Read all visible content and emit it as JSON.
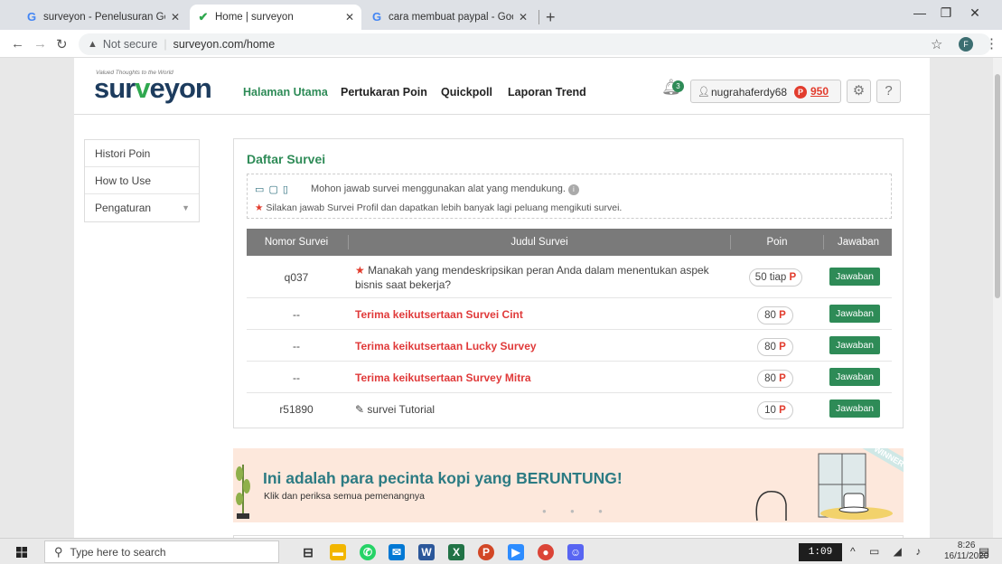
{
  "browser": {
    "tabs": [
      {
        "title": "surveyon - Penelusuran Google",
        "favicon": "G"
      },
      {
        "title": "Home | surveyon",
        "favicon": "✔"
      },
      {
        "title": "cara membuat paypal - Google S",
        "favicon": "G"
      }
    ],
    "not_secure": "Not secure",
    "url": "surveyon.com/home",
    "profile_initial": "F"
  },
  "site": {
    "tagline": "Valued Thoughts to the World",
    "logo_a": "sur",
    "logo_b": "v",
    "logo_c": "eyon",
    "nav": [
      "Halaman Utama",
      "Pertukaran Poin",
      "Quickpoll",
      "Laporan Trend"
    ],
    "notification_count": "3",
    "username": "nugrahaferdy68",
    "points_badge": "P",
    "points": "950",
    "help": "?"
  },
  "sidebar": {
    "items": [
      {
        "label": "Histori Poin"
      },
      {
        "label": "How to Use"
      },
      {
        "label": "Pengaturan"
      }
    ]
  },
  "survey": {
    "title": "Daftar Survei",
    "notice_device": "Mohon jawab survei menggunakan alat yang mendukung.",
    "notice_profile": "Silakan jawab Survei Profil dan dapatkan lebih banyak lagi peluang mengikuti survei.",
    "columns": [
      "Nomor Survei",
      "Judul Survei",
      "Poin",
      "Jawaban"
    ],
    "rows": [
      {
        "num": "q037",
        "title": "Manakah yang mendeskripsikan peran Anda dalam menentukan aspek bisnis saat bekerja?",
        "points": "50 tiap",
        "p": "P",
        "action": "Jawaban"
      },
      {
        "num": "--",
        "title": "Terima keikutsertaan Survei Cint",
        "points": "80",
        "p": "P",
        "action": "Jawaban"
      },
      {
        "num": "--",
        "title": "Terima keikutsertaan Lucky Survey",
        "points": "80",
        "p": "P",
        "action": "Jawaban"
      },
      {
        "num": "--",
        "title": "Terima keikutsertaan Survey Mitra",
        "points": "80",
        "p": "P",
        "action": "Jawaban"
      },
      {
        "num": "r51890",
        "title": "survei Tutorial",
        "points": "10",
        "p": "P",
        "action": "Jawaban"
      }
    ]
  },
  "banner": {
    "title": "Ini adalah para pecinta kopi yang BERUNTUNG!",
    "subtitle": "Klik dan periksa semua pemenangnya",
    "badge": "WINNER"
  },
  "taskbar": {
    "search_placeholder": "Type here to search",
    "media_time": "1:09",
    "time": "8:26",
    "date": "16/11/2020"
  },
  "colors": {
    "brand_green": "#2e8b57",
    "points_red": "#e23c2d",
    "logo_navy": "#1d3c5e"
  }
}
